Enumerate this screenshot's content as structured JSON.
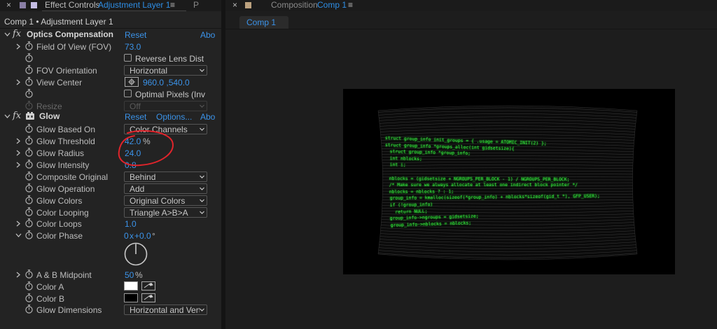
{
  "effect_controls": {
    "tab_close": "×",
    "tab_title": "Effect Controls",
    "tab_layer": "Adjustment Layer 1",
    "tab_menu": "≡",
    "tab_overflow": "P",
    "breadcrumb": "Comp 1 • Adjustment Layer 1",
    "optics": {
      "fx": "fx",
      "name": "Optics Compensation",
      "reset": "Reset",
      "about": "Abo",
      "fov_label": "Field Of View (FOV)",
      "fov_value": "73.0",
      "reverse_label": "Reverse Lens Dist",
      "orientation_label": "FOV Orientation",
      "orientation_value": "Horizontal",
      "view_center_label": "View Center",
      "view_center_value": "960.0 ,540.0",
      "optimal_label": "Optimal Pixels (Inv",
      "resize_label": "Resize",
      "resize_value": "Off"
    },
    "glow": {
      "fx": "fx",
      "name": "Glow",
      "reset": "Reset",
      "options": "Options...",
      "about": "Abo",
      "based_on_label": "Glow Based On",
      "based_on_value": "Color Channels",
      "threshold_label": "Glow Threshold",
      "threshold_value": "42.0",
      "threshold_unit": "%",
      "radius_label": "Glow Radius",
      "radius_value": "24.0",
      "intensity_label": "Glow Intensity",
      "intensity_value": "0.8",
      "composite_label": "Composite Original",
      "composite_value": "Behind",
      "operation_label": "Glow Operation",
      "operation_value": "Add",
      "colors_label": "Glow Colors",
      "colors_value": "Original Colors",
      "looping_label": "Color Looping",
      "looping_value": "Triangle A>B>A",
      "loops_label": "Color Loops",
      "loops_value": "1.0",
      "phase_label": "Color Phase",
      "phase_revs": "0",
      "phase_x": "x",
      "phase_deg": "+0.0",
      "phase_deg_unit": "°",
      "midpoint_label": "A & B Midpoint",
      "midpoint_value": "50",
      "midpoint_unit": "%",
      "color_a_label": "Color A",
      "color_a": "#ffffff",
      "color_b_label": "Color B",
      "color_b": "#000000",
      "dimensions_label": "Glow Dimensions",
      "dimensions_value": "Horizontal and Vert"
    }
  },
  "composition": {
    "tab_close": "×",
    "tab_title": "Composition",
    "tab_comp": "Comp 1",
    "tab_menu": "≡",
    "comp_tab": "Comp 1",
    "code_lines": [
      "struct group_info init_groups = { .usage = ATOMIC_INIT(2) };",
      "struct group_info *groups_alloc(int gidsetsize){",
      "  struct group_info *group_info;",
      "  int nblocks;",
      "  int i;",
      "",
      "  nblocks = (gidsetsize + NGROUPS_PER_BLOCK - 1) / NGROUPS_PER_BLOCK;",
      "  /* Make sure we always allocate at least one indirect block pointer */",
      "  nblocks = nblocks ? : 1;",
      "  group_info = kmalloc(sizeof(*group_info) + nblocks*sizeof(gid_t *), GFP_USER);",
      "  if (!group_info)",
      "    return NULL;",
      "  group_info->ngroups = gidsetsize;",
      "  group_info->nblocks = nblocks;"
    ]
  },
  "colors": {
    "accent_blue": "#3b93e9",
    "annotation_red": "#e0242b",
    "terminal_green": "#34e03a"
  }
}
